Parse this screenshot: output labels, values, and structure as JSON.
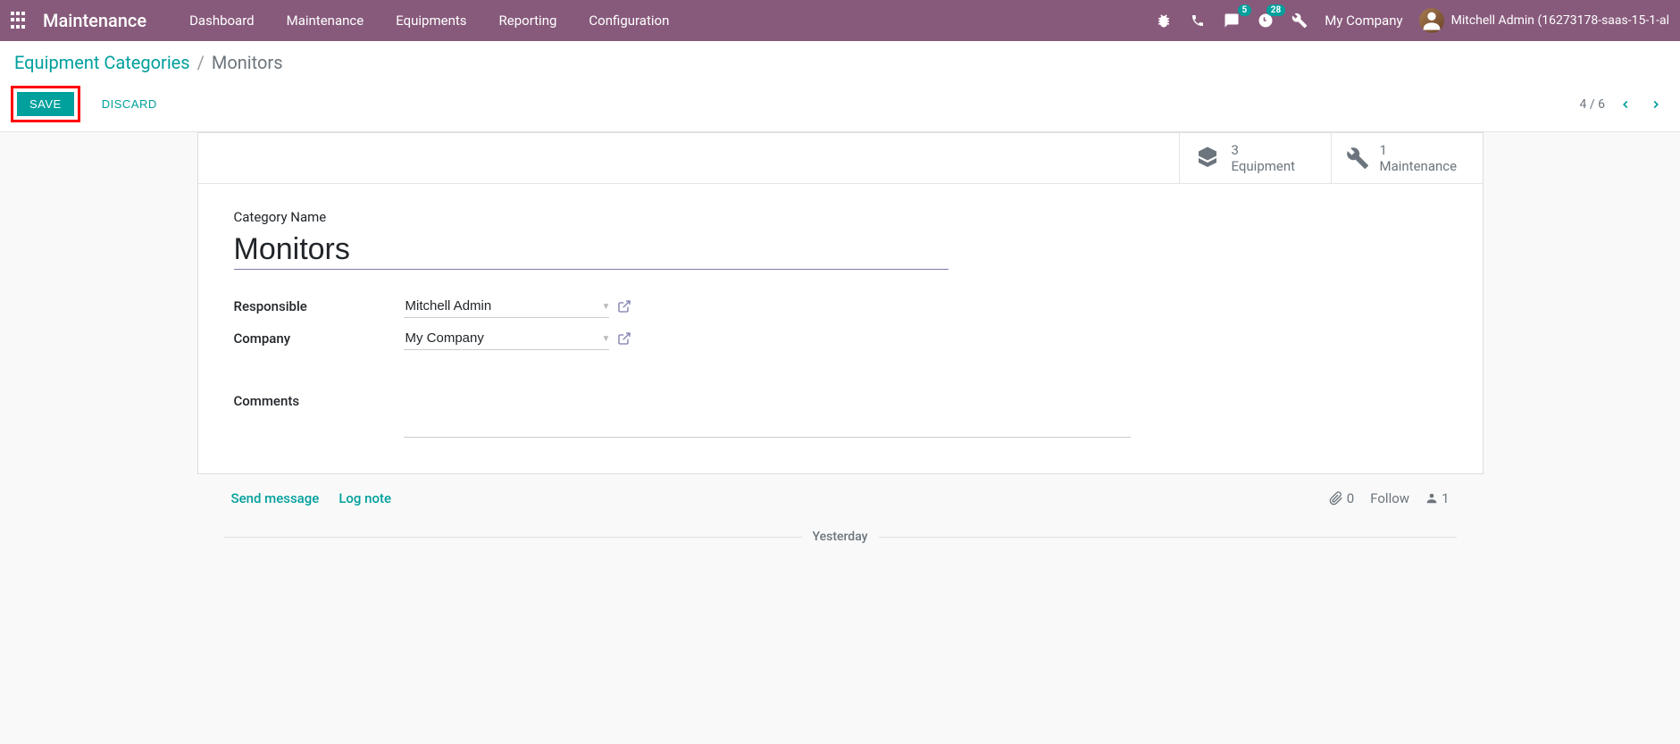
{
  "navbar": {
    "brand": "Maintenance",
    "menu": [
      "Dashboard",
      "Maintenance",
      "Equipments",
      "Reporting",
      "Configuration"
    ],
    "messaging_badge": "5",
    "activities_badge": "28",
    "company": "My Company",
    "user": "Mitchell Admin (16273178-saas-15-1-al"
  },
  "breadcrumb": {
    "parent": "Equipment Categories",
    "current": "Monitors"
  },
  "actions": {
    "save": "SAVE",
    "discard": "DISCARD"
  },
  "pager": {
    "position": "4 / 6"
  },
  "stats": {
    "equipment": {
      "count": "3",
      "label": "Equipment"
    },
    "maintenance": {
      "count": "1",
      "label": "Maintenance"
    }
  },
  "form": {
    "title_label": "Category Name",
    "title_value": "Monitors",
    "responsible_label": "Responsible",
    "responsible_value": "Mitchell Admin",
    "company_label": "Company",
    "company_value": "My Company",
    "comments_label": "Comments"
  },
  "chatter": {
    "send_message": "Send message",
    "log_note": "Log note",
    "attachments": "0",
    "follow": "Follow",
    "followers": "1",
    "divider": "Yesterday"
  }
}
